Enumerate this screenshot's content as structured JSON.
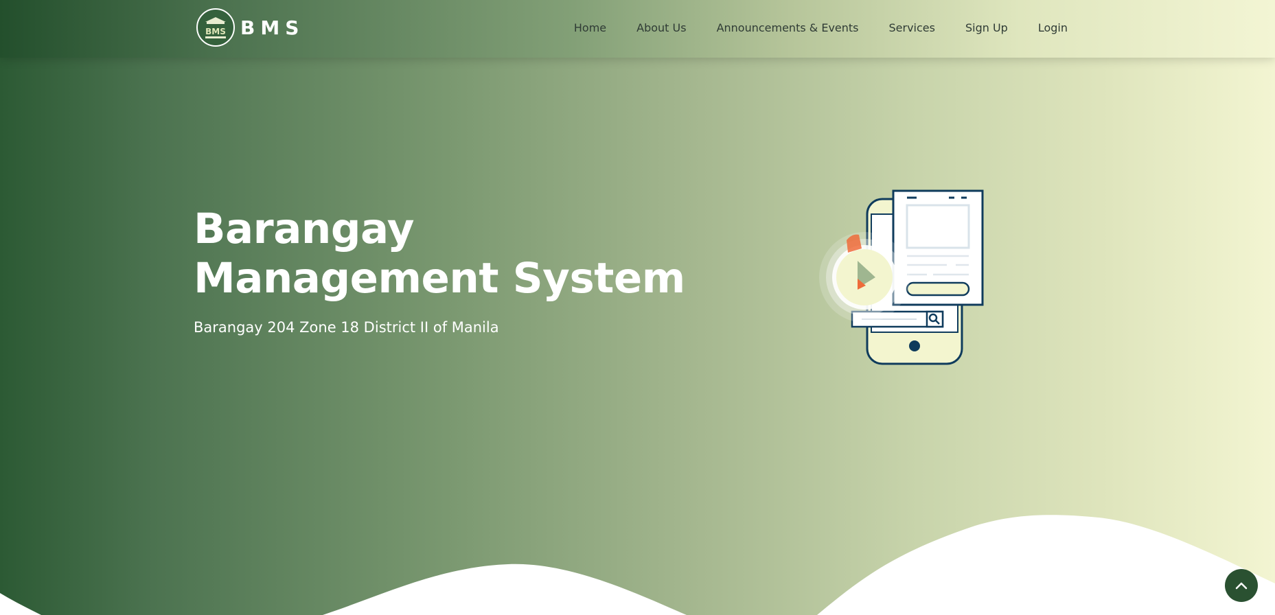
{
  "navbar": {
    "brand_text": "BMS",
    "logo_letters": "BMS",
    "links": [
      {
        "label": "Home"
      },
      {
        "label": "About Us"
      },
      {
        "label": "Announcements & Events"
      },
      {
        "label": "Services"
      },
      {
        "label": "Sign Up"
      },
      {
        "label": "Login"
      }
    ]
  },
  "hero": {
    "title_line1": "Barangay",
    "title_line2": "Management System",
    "subtitle": "Barangay 204 Zone 18 District II of Manila"
  },
  "icons": {
    "scroll_top": "chevron-up-icon",
    "play": "play-icon",
    "search": "search-icon"
  },
  "colors": {
    "primary": "#2a5131",
    "accent": "#f3f5d2",
    "text_dark": "#2f3b35",
    "illustration_stroke": "#0f3b5c",
    "illustration_orange": "#ee6b3a"
  }
}
